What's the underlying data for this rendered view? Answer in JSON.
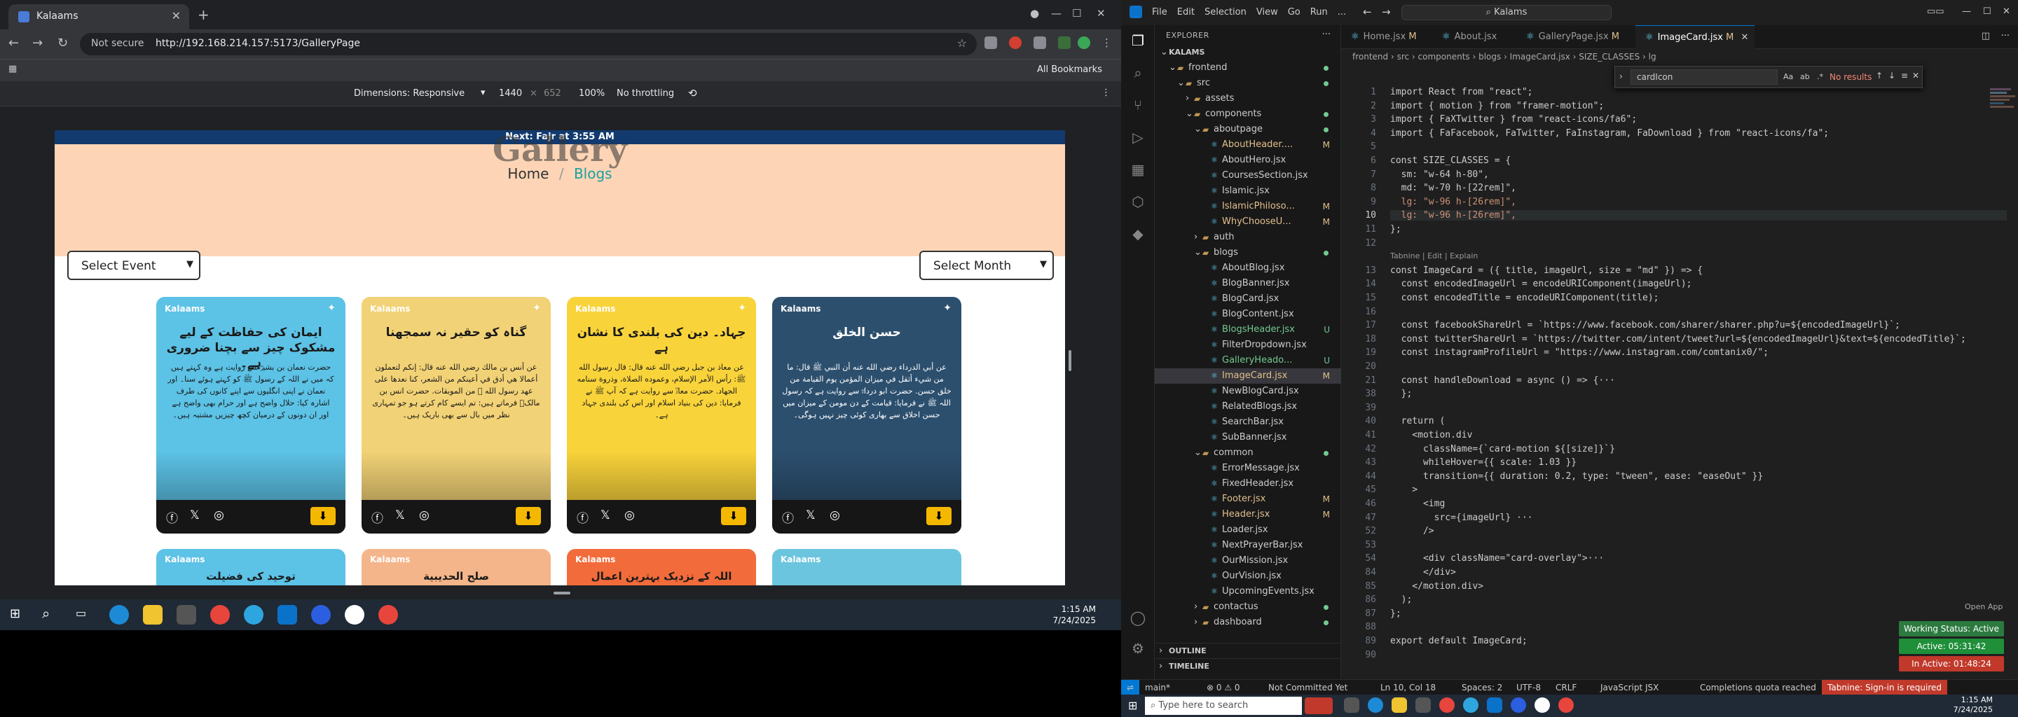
{
  "browser": {
    "tab_title": "Kalaams",
    "address_security": "Not secure",
    "url": "http://192.168.214.157:5173/GalleryPage",
    "bookmarks_label": "All Bookmarks",
    "devtools": {
      "dimensions_label": "Dimensions: Responsive",
      "width": "1440",
      "height": "652",
      "zoom": "100%",
      "throttling": "No throttling"
    }
  },
  "site": {
    "prayer_bar": "Next: Fajr at 3:55 AM",
    "hero_title": "Gallery",
    "breadcrumb_home": "Home",
    "breadcrumb_sep": "/",
    "breadcrumb_current": "Blogs",
    "select_event": "Select Event",
    "select_month": "Select Month",
    "cards": [
      {
        "brand": "Kalaams",
        "heading": "ایمان کی حفاظت کے لیے مشکوک چیز سے بچنا ضروری ہے۔",
        "body": "حضرت نعمان بن بشیرؓ سے روایت ہے وہ کہتے ہیں کہ میں نے اللہ کے رسول ﷺ کو کہتے ہوئے سنا۔ اور نعمان نے اپنی انگلیوں سے اپنے کانوں کی طرف اشارہ کیا: حلال واضح ہے اور حرام بھی واضح ہے اور ان دونوں کے درمیان کچھ چیزیں مشتبہ ہیں۔",
        "color": "#5cc2e6"
      },
      {
        "brand": "Kalaams",
        "heading": "گناہ کو حقیر نہ سمجھنا",
        "body": "عن أنس بن مالك رضي الله عنه قال: إنكم لتعملون أعمالا هي أدق في أعينكم من الشعر، كنا نعدها على عهد رسول الله ﷺ من الموبقات. حضرت انس بن مالکؓ فرماتے ہیں: تم ایسے کام کرتے ہو جو تمہاری نظر میں بال سے بھی باریک ہیں۔",
        "color": "#f2d276"
      },
      {
        "brand": "Kalaams",
        "heading": "جہاد۔ دین کی بلندی کا نشان ہے",
        "body": "عن معاذ بن جبل رضي الله عنه قال: قال رسول الله ﷺ: رأس الأمر الإسلام، وعموده الصلاة، وذروة سنامه الجهاد. حضرت معاذؓ سے روایت ہے کہ آپ ﷺ نے فرمایا: دین کی بنیاد اسلام اور اس کی بلندی جہاد ہے۔",
        "color": "#f9d33a"
      },
      {
        "brand": "Kalaams",
        "heading": "حسن الخلق",
        "body": "عن أبي الدرداء رضي الله عنه أن النبي ﷺ قال: ما من شيء أثقل في ميزان المؤمن يوم القيامة من خلق حسن. حضرت ابو درداءؓ سے روایت ہے کہ رسول اللہ ﷺ نے فرمایا: قیامت کے دن مومن کے میزان میں حسن اخلاق سے بھاری کوئی چیز نہیں ہوگی۔",
        "color": "#2c4f6e"
      }
    ],
    "cards_row2": [
      {
        "brand": "Kalaams",
        "heading": "توحید کی فضیلت",
        "color": "#5cc2e6"
      },
      {
        "brand": "Kalaams",
        "heading": "صلح الحدیبیة",
        "color": "#f4b58a"
      },
      {
        "brand": "Kalaams",
        "heading": "اللہ کے نزدیک بہترین اعمال",
        "color": "#f26b3a"
      },
      {
        "brand": "Kalaams",
        "heading": "",
        "color": "#6bc5de"
      }
    ]
  },
  "left_taskbar": {
    "time": "1:15 AM",
    "date": "7/24/2025"
  },
  "vscode": {
    "menu": [
      "File",
      "Edit",
      "Selection",
      "View",
      "Go",
      "Run",
      "..."
    ],
    "search": "Kalams",
    "explorer_title": "EXPLORER",
    "tree": [
      {
        "name": "KALAMS",
        "depth": 0,
        "kind": "root",
        "status": ""
      },
      {
        "name": "frontend",
        "depth": 1,
        "kind": "folder",
        "status": "dot"
      },
      {
        "name": "src",
        "depth": 2,
        "kind": "folder",
        "status": "dot"
      },
      {
        "name": "assets",
        "depth": 3,
        "kind": "folder-closed",
        "status": ""
      },
      {
        "name": "components",
        "depth": 3,
        "kind": "folder",
        "status": "dot"
      },
      {
        "name": "aboutpage",
        "depth": 4,
        "kind": "folder",
        "status": "dot"
      },
      {
        "name": "AboutHeader....",
        "depth": 5,
        "kind": "file",
        "status": "M"
      },
      {
        "name": "AboutHero.jsx",
        "depth": 5,
        "kind": "file",
        "status": ""
      },
      {
        "name": "CoursesSection.jsx",
        "depth": 5,
        "kind": "file",
        "status": ""
      },
      {
        "name": "Islamic.jsx",
        "depth": 5,
        "kind": "file",
        "status": ""
      },
      {
        "name": "IslamicPhiloso...",
        "depth": 5,
        "kind": "file",
        "status": "M"
      },
      {
        "name": "WhyChooseU...",
        "depth": 5,
        "kind": "file",
        "status": "M"
      },
      {
        "name": "auth",
        "depth": 4,
        "kind": "folder-closed",
        "status": ""
      },
      {
        "name": "blogs",
        "depth": 4,
        "kind": "folder",
        "status": "dot"
      },
      {
        "name": "AboutBlog.jsx",
        "depth": 5,
        "kind": "file",
        "status": ""
      },
      {
        "name": "BlogBanner.jsx",
        "depth": 5,
        "kind": "file",
        "status": ""
      },
      {
        "name": "BlogCard.jsx",
        "depth": 5,
        "kind": "file",
        "status": ""
      },
      {
        "name": "BlogContent.jsx",
        "depth": 5,
        "kind": "file",
        "status": ""
      },
      {
        "name": "BlogsHeader.jsx",
        "depth": 5,
        "kind": "file",
        "status": "U"
      },
      {
        "name": "FilterDropdown.jsx",
        "depth": 5,
        "kind": "file",
        "status": ""
      },
      {
        "name": "GalleryHeado...",
        "depth": 5,
        "kind": "file",
        "status": "U"
      },
      {
        "name": "ImageCard.jsx",
        "depth": 5,
        "kind": "file",
        "status": "M"
      },
      {
        "name": "NewBlogCard.jsx",
        "depth": 5,
        "kind": "file",
        "status": ""
      },
      {
        "name": "RelatedBlogs.jsx",
        "depth": 5,
        "kind": "file",
        "status": ""
      },
      {
        "name": "SearchBar.jsx",
        "depth": 5,
        "kind": "file",
        "status": ""
      },
      {
        "name": "SubBanner.jsx",
        "depth": 5,
        "kind": "file",
        "status": ""
      },
      {
        "name": "common",
        "depth": 4,
        "kind": "folder",
        "status": "dot"
      },
      {
        "name": "ErrorMessage.jsx",
        "depth": 5,
        "kind": "file",
        "status": ""
      },
      {
        "name": "FixedHeader.jsx",
        "depth": 5,
        "kind": "file",
        "status": ""
      },
      {
        "name": "Footer.jsx",
        "depth": 5,
        "kind": "file",
        "status": "M"
      },
      {
        "name": "Header.jsx",
        "depth": 5,
        "kind": "file",
        "status": "M"
      },
      {
        "name": "Loader.jsx",
        "depth": 5,
        "kind": "file",
        "status": ""
      },
      {
        "name": "NextPrayerBar.jsx",
        "depth": 5,
        "kind": "file",
        "status": ""
      },
      {
        "name": "OurMission.jsx",
        "depth": 5,
        "kind": "file",
        "status": ""
      },
      {
        "name": "OurVision.jsx",
        "depth": 5,
        "kind": "file",
        "status": ""
      },
      {
        "name": "UpcomingEvents.jsx",
        "depth": 5,
        "kind": "file",
        "status": ""
      },
      {
        "name": "contactus",
        "depth": 4,
        "kind": "folder-closed",
        "status": "dot"
      },
      {
        "name": "dashboard",
        "depth": 4,
        "kind": "folder-closed",
        "status": "dot"
      }
    ],
    "outline_label": "OUTLINE",
    "timeline_label": "TIMELINE",
    "tabs": [
      {
        "label": "Home.jsx",
        "status": "M"
      },
      {
        "label": "About.jsx",
        "status": ""
      },
      {
        "label": "GalleryPage.jsx",
        "status": "M"
      },
      {
        "label": "ImageCard.jsx",
        "status": "M"
      }
    ],
    "breadcrumb": "frontend › src › components › blogs › ImageCard.jsx › SIZE_CLASSES › lg",
    "find": {
      "query": "cardIcon",
      "result": "No results"
    },
    "codelens": "Tabnine | Edit | Explain",
    "code_lines": [
      {
        "n": "1",
        "text": "import React from \"react\";"
      },
      {
        "n": "2",
        "text": "import { motion } from \"framer-motion\";"
      },
      {
        "n": "3",
        "text": "import { FaXTwitter } from \"react-icons/fa6\";"
      },
      {
        "n": "4",
        "text": "import { FaFacebook, FaTwitter, FaInstagram, FaDownload } from \"react-icons/fa\";"
      },
      {
        "n": "5",
        "text": ""
      },
      {
        "n": "6",
        "text": "const SIZE_CLASSES = {"
      },
      {
        "n": "7",
        "text": "  sm: \"w-64 h-80\","
      },
      {
        "n": "8",
        "text": "  md: \"w-70 h-[22rem]\","
      },
      {
        "n": "9",
        "text": "  lg: \"w-96 h-[26rem]\","
      },
      {
        "n": "10",
        "text": "  lg: \"w-96 h-[26rem]\","
      },
      {
        "n": "11",
        "text": "};"
      },
      {
        "n": "12",
        "text": ""
      },
      {
        "n": "13",
        "text": "const ImageCard = ({ title, imageUrl, size = \"md\" }) => {"
      },
      {
        "n": "14",
        "text": "  const encodedImageUrl = encodeURIComponent(imageUrl);"
      },
      {
        "n": "15",
        "text": "  const encodedTitle = encodeURIComponent(title);"
      },
      {
        "n": "16",
        "text": ""
      },
      {
        "n": "17",
        "text": "  const facebookShareUrl = `https://www.facebook.com/sharer/sharer.php?u=${encodedImageUrl}`;"
      },
      {
        "n": "18",
        "text": "  const twitterShareUrl = `https://twitter.com/intent/tweet?url=${encodedImageUrl}&text=${encodedTitle}`;"
      },
      {
        "n": "19",
        "text": "  const instagramProfileUrl = \"https://www.instagram.com/comtanix0/\";"
      },
      {
        "n": "20",
        "text": ""
      },
      {
        "n": "21",
        "text": "  const handleDownload = async () => {···"
      },
      {
        "n": "38",
        "text": "  };"
      },
      {
        "n": "39",
        "text": ""
      },
      {
        "n": "40",
        "text": "  return ("
      },
      {
        "n": "41",
        "text": "    <motion.div"
      },
      {
        "n": "42",
        "text": "      className={`card-motion ${[size]}`}"
      },
      {
        "n": "43",
        "text": "      whileHover={{ scale: 1.03 }}"
      },
      {
        "n": "44",
        "text": "      transition={{ duration: 0.2, type: \"tween\", ease: \"easeOut\" }}"
      },
      {
        "n": "45",
        "text": "    >"
      },
      {
        "n": "46",
        "text": "      <img"
      },
      {
        "n": "47",
        "text": "        src={imageUrl} ···"
      },
      {
        "n": "52",
        "text": "      />"
      },
      {
        "n": "53",
        "text": ""
      },
      {
        "n": "54",
        "text": "      <div className=\"card-overlay\">···"
      },
      {
        "n": "84",
        "text": "      </div>"
      },
      {
        "n": "85",
        "text": "    </motion.div>"
      },
      {
        "n": "86",
        "text": "  );"
      },
      {
        "n": "87",
        "text": "};"
      },
      {
        "n": "88",
        "text": ""
      },
      {
        "n": "89",
        "text": "export default ImageCard;"
      },
      {
        "n": "90",
        "text": ""
      }
    ],
    "open_app": "Open App",
    "working_status": "Working Status: Active",
    "active_time": "Active: 05:31:42",
    "inactive_time": "In Active: 01:48:24",
    "status_bar": {
      "branch": "main*",
      "problems": "⊗ 0 ⚠ 0",
      "not_committed": "Not Committed Yet",
      "cursor": "Ln 10, Col 18",
      "spaces": "Spaces: 2",
      "encoding": "UTF-8",
      "eol": "CRLF",
      "language": "JavaScript JSX",
      "quota": "Completions quota reached",
      "tabnine": "Tabnine: Sign-in is required"
    },
    "taskbar": {
      "search": "Type here to search",
      "time": "1:15 AM",
      "date": "7/24/2025"
    }
  }
}
